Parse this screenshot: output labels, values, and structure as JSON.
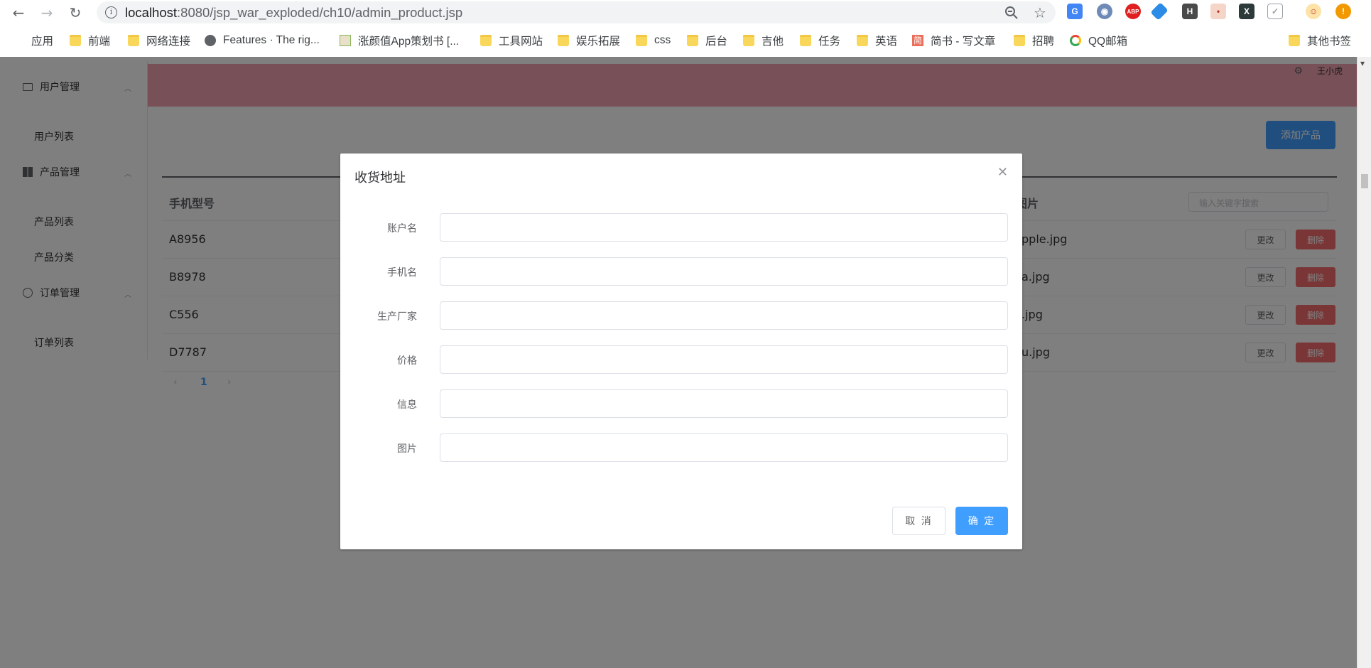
{
  "browser": {
    "url_host": "localhost",
    "url_path": ":8080/jsp_war_exploded/ch10/admin_product.jsp",
    "extensions": [
      "google-translate-icon",
      "opera-icon",
      "adblock-plus-icon",
      "tag-icon",
      "h-icon",
      "person-icon",
      "x-icon",
      "shield-icon",
      "avatar-icon",
      "warning-icon"
    ],
    "ext_labels": {
      "abp": "ABP",
      "h": "H",
      "x": "X",
      "warn": "!"
    }
  },
  "bookmarks": {
    "items": [
      "应用",
      "前端",
      "网络连接",
      "Features · The rig...",
      "涨颜值App策划书 [...",
      "工具网站",
      "娱乐拓展",
      "css",
      "后台",
      "吉他",
      "任务",
      "英语",
      "简书 - 写文章",
      "招聘",
      "QQ邮箱"
    ],
    "other": "其他书签",
    "jianshu_icon_char": "简"
  },
  "sidebar": {
    "groups": [
      {
        "title": "用户管理",
        "items": [
          "用户列表"
        ]
      },
      {
        "title": "产品管理",
        "items": [
          "产品列表",
          "产品分类"
        ]
      },
      {
        "title": "订单管理",
        "items": [
          "订单列表"
        ]
      }
    ]
  },
  "header": {
    "username": "王小虎"
  },
  "toolbar": {
    "add_label": "添加产品"
  },
  "table": {
    "headers": [
      "手机型号",
      "图片"
    ],
    "search_placeholder": "输入关键字搜索",
    "rows": [
      {
        "model": "A8956",
        "image": "pple.jpg"
      },
      {
        "model": "B8978",
        "image": "a.jpg"
      },
      {
        "model": "C556",
        "image": ".jpg"
      },
      {
        "model": "D7787",
        "image": "u.jpg"
      }
    ],
    "edit_label": "更改",
    "delete_label": "删除"
  },
  "pagination": {
    "current": "1"
  },
  "dialog": {
    "title": "收货地址",
    "fields": [
      "账户名",
      "手机名",
      "生产厂家",
      "价格",
      "信息",
      "图片"
    ],
    "cancel_label": "取 消",
    "ok_label": "确 定"
  },
  "colors": {
    "primary": "#409eff",
    "danger": "#f56c6c",
    "header": "#f0a3b0"
  }
}
